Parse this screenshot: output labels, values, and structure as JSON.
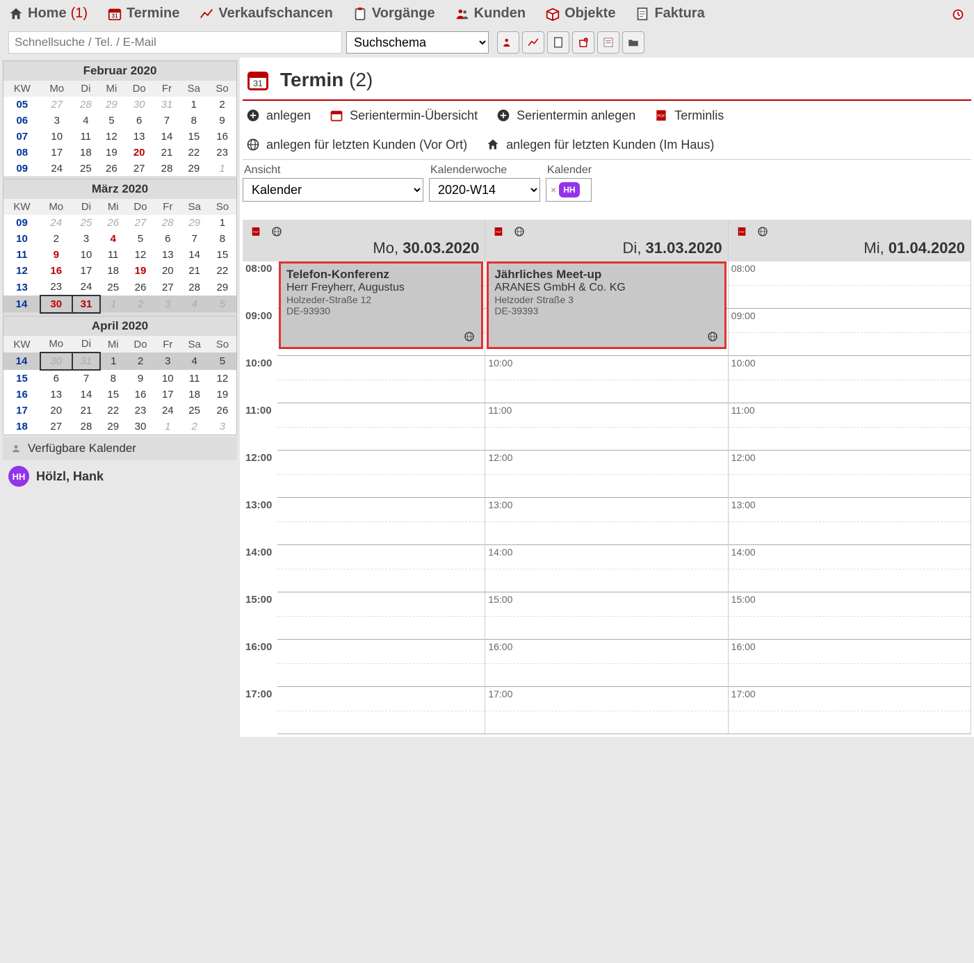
{
  "nav": {
    "home": "Home",
    "home_count": "(1)",
    "termine": "Termine",
    "verkaufschancen": "Verkaufschancen",
    "vorgaenge": "Vorgänge",
    "kunden": "Kunden",
    "objekte": "Objekte",
    "faktura": "Faktura"
  },
  "search": {
    "placeholder": "Schnellsuche / Tel. / E-Mail",
    "schema_label": "Suchschema"
  },
  "sidebar": {
    "months": [
      {
        "title": "Februar 2020",
        "header": [
          "KW",
          "Mo",
          "Di",
          "Mi",
          "Do",
          "Fr",
          "Sa",
          "So"
        ],
        "rows": [
          {
            "kw": "05",
            "cells": [
              {
                "t": "27",
                "o": true
              },
              {
                "t": "28",
                "o": true
              },
              {
                "t": "29",
                "o": true
              },
              {
                "t": "30",
                "o": true
              },
              {
                "t": "31",
                "o": true
              },
              {
                "t": "1"
              },
              {
                "t": "2"
              }
            ]
          },
          {
            "kw": "06",
            "cells": [
              {
                "t": "3"
              },
              {
                "t": "4"
              },
              {
                "t": "5"
              },
              {
                "t": "6"
              },
              {
                "t": "7"
              },
              {
                "t": "8"
              },
              {
                "t": "9"
              }
            ]
          },
          {
            "kw": "07",
            "cells": [
              {
                "t": "10"
              },
              {
                "t": "11"
              },
              {
                "t": "12"
              },
              {
                "t": "13"
              },
              {
                "t": "14"
              },
              {
                "t": "15"
              },
              {
                "t": "16"
              }
            ]
          },
          {
            "kw": "08",
            "cells": [
              {
                "t": "17"
              },
              {
                "t": "18"
              },
              {
                "t": "19"
              },
              {
                "t": "20",
                "r": true
              },
              {
                "t": "21"
              },
              {
                "t": "22"
              },
              {
                "t": "23"
              }
            ]
          },
          {
            "kw": "09",
            "cells": [
              {
                "t": "24"
              },
              {
                "t": "25"
              },
              {
                "t": "26"
              },
              {
                "t": "27"
              },
              {
                "t": "28"
              },
              {
                "t": "29"
              },
              {
                "t": "1",
                "o": true
              }
            ]
          }
        ]
      },
      {
        "title": "März 2020",
        "header": [
          "KW",
          "Mo",
          "Di",
          "Mi",
          "Do",
          "Fr",
          "Sa",
          "So"
        ],
        "rows": [
          {
            "kw": "09",
            "cells": [
              {
                "t": "24",
                "o": true
              },
              {
                "t": "25",
                "o": true
              },
              {
                "t": "26",
                "o": true
              },
              {
                "t": "27",
                "o": true
              },
              {
                "t": "28",
                "o": true
              },
              {
                "t": "29",
                "o": true
              },
              {
                "t": "1"
              }
            ]
          },
          {
            "kw": "10",
            "cells": [
              {
                "t": "2"
              },
              {
                "t": "3"
              },
              {
                "t": "4",
                "r": true
              },
              {
                "t": "5"
              },
              {
                "t": "6"
              },
              {
                "t": "7"
              },
              {
                "t": "8"
              }
            ]
          },
          {
            "kw": "11",
            "cells": [
              {
                "t": "9",
                "r": true
              },
              {
                "t": "10"
              },
              {
                "t": "11"
              },
              {
                "t": "12"
              },
              {
                "t": "13"
              },
              {
                "t": "14"
              },
              {
                "t": "15"
              }
            ]
          },
          {
            "kw": "12",
            "cells": [
              {
                "t": "16",
                "r": true
              },
              {
                "t": "17"
              },
              {
                "t": "18"
              },
              {
                "t": "19",
                "r": true
              },
              {
                "t": "20"
              },
              {
                "t": "21"
              },
              {
                "t": "22"
              }
            ]
          },
          {
            "kw": "13",
            "cells": [
              {
                "t": "23"
              },
              {
                "t": "24"
              },
              {
                "t": "25"
              },
              {
                "t": "26"
              },
              {
                "t": "27"
              },
              {
                "t": "28"
              },
              {
                "t": "29"
              }
            ]
          },
          {
            "kw": "14",
            "hl": true,
            "cells": [
              {
                "t": "30",
                "r": true,
                "b": true
              },
              {
                "t": "31",
                "r": true,
                "b": true
              },
              {
                "t": "1",
                "o": true
              },
              {
                "t": "2",
                "o": true
              },
              {
                "t": "3",
                "o": true
              },
              {
                "t": "4",
                "o": true
              },
              {
                "t": "5",
                "o": true
              }
            ]
          }
        ]
      },
      {
        "title": "April 2020",
        "header": [
          "KW",
          "Mo",
          "Di",
          "Mi",
          "Do",
          "Fr",
          "Sa",
          "So"
        ],
        "rows": [
          {
            "kw": "14",
            "hl": true,
            "cells": [
              {
                "t": "30",
                "o": true,
                "b": true
              },
              {
                "t": "31",
                "o": true,
                "b": true
              },
              {
                "t": "1"
              },
              {
                "t": "2"
              },
              {
                "t": "3"
              },
              {
                "t": "4"
              },
              {
                "t": "5"
              }
            ]
          },
          {
            "kw": "15",
            "cells": [
              {
                "t": "6"
              },
              {
                "t": "7"
              },
              {
                "t": "8"
              },
              {
                "t": "9"
              },
              {
                "t": "10"
              },
              {
                "t": "11"
              },
              {
                "t": "12"
              }
            ]
          },
          {
            "kw": "16",
            "cells": [
              {
                "t": "13"
              },
              {
                "t": "14"
              },
              {
                "t": "15"
              },
              {
                "t": "16"
              },
              {
                "t": "17"
              },
              {
                "t": "18"
              },
              {
                "t": "19"
              }
            ]
          },
          {
            "kw": "17",
            "cells": [
              {
                "t": "20"
              },
              {
                "t": "21"
              },
              {
                "t": "22"
              },
              {
                "t": "23"
              },
              {
                "t": "24"
              },
              {
                "t": "25"
              },
              {
                "t": "26"
              }
            ]
          },
          {
            "kw": "18",
            "cells": [
              {
                "t": "27"
              },
              {
                "t": "28"
              },
              {
                "t": "29"
              },
              {
                "t": "30"
              },
              {
                "t": "1",
                "o": true
              },
              {
                "t": "2",
                "o": true
              },
              {
                "t": "3",
                "o": true
              }
            ]
          }
        ]
      }
    ],
    "available_header": "Verfügbare Kalender",
    "available": [
      {
        "initials": "HH",
        "name": "Hölzl, Hank"
      }
    ]
  },
  "content": {
    "title_bold": "Termin",
    "title_rest": "(2)",
    "actions": {
      "anlegen": "anlegen",
      "serien_uebersicht": "Serientermin-Übersicht",
      "serien_anlegen": "Serientermin anlegen",
      "terminlis": "Terminlis",
      "anlegen_vor_ort": "anlegen für letzten Kunden (Vor Ort)",
      "anlegen_im_haus": "anlegen für letzten Kunden (Im Haus)"
    },
    "filters": {
      "ansicht_label": "Ansicht",
      "ansicht_value": "Kalender",
      "kw_label": "Kalenderwoche",
      "kw_value": "2020-W14",
      "cal_label": "Kalender",
      "cal_tag": "HH"
    },
    "days": [
      {
        "short": "Mo,",
        "date": "30.03.2020",
        "events": [
          {
            "title": "Telefon-Konferenz",
            "line1": "Herr Freyherr, Augustus",
            "small1": "Holzeder-Straße 12",
            "small2": "DE-93930",
            "top": 0,
            "height": 126
          }
        ]
      },
      {
        "short": "Di,",
        "date": "31.03.2020",
        "events": [
          {
            "title": "Jährliches Meet-up",
            "line1": "ARANES GmbH & Co. KG",
            "small1": "Helzoder Straße 3",
            "small2": "DE-39393",
            "top": 0,
            "height": 126
          }
        ]
      },
      {
        "short": "Mi,",
        "date": "01.04.2020",
        "events": []
      }
    ],
    "hours": [
      "08:00",
      "09:00",
      "10:00",
      "11:00",
      "12:00",
      "13:00",
      "14:00",
      "15:00",
      "16:00",
      "17:00"
    ]
  }
}
